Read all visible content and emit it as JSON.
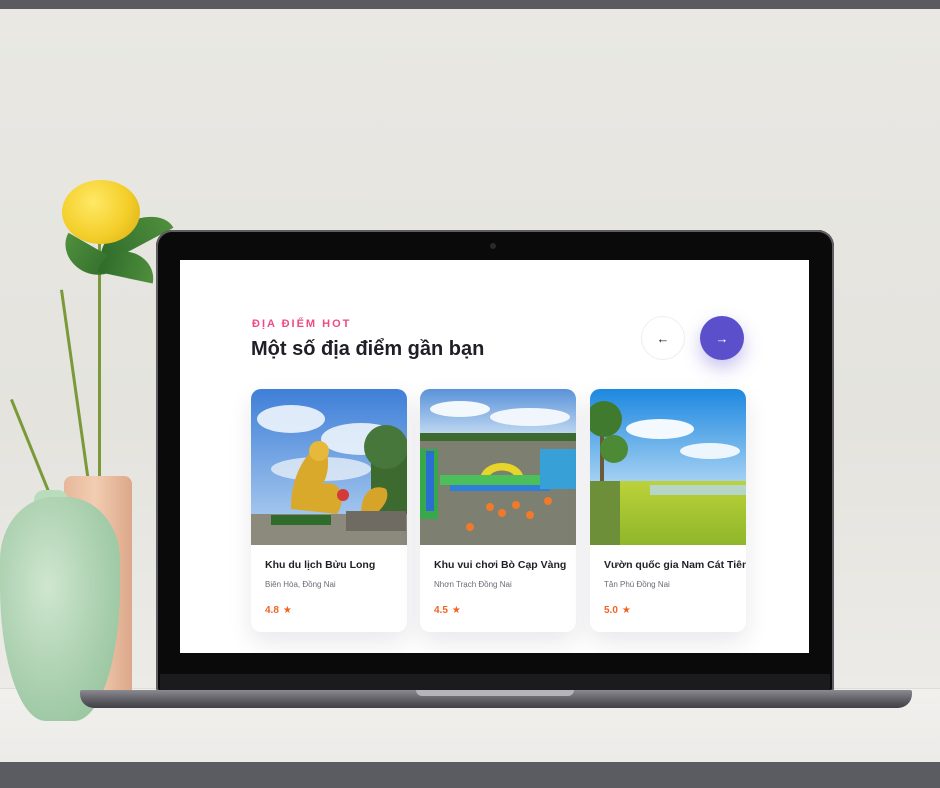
{
  "section": {
    "eyebrow": "ĐỊA ĐIỂM HOT",
    "title": "Một số địa điểm gần bạn"
  },
  "nav": {
    "prev_icon": "←",
    "next_icon": "→"
  },
  "places": [
    {
      "name": "Khu du lịch Bửu Long",
      "location": "Biên Hòa, Đồng Nai",
      "rating": "4.8",
      "image": "dragon-statue-park-photo"
    },
    {
      "name": "Khu vui chơi Bò Cạp Vàng",
      "location": "Nhơn Trạch Đồng Nai",
      "rating": "4.5",
      "image": "inflatable-water-park-photo"
    },
    {
      "name": "Vườn quốc gia Nam Cát Tiên",
      "location": "Tân Phú Đồng Nai",
      "rating": "5.0",
      "image": "grassland-lake-photo"
    }
  ],
  "colors": {
    "accent": "#5b4fcb",
    "eyebrow": "#ee4a86",
    "rating": "#f26322"
  },
  "icons": {
    "star": "★"
  }
}
